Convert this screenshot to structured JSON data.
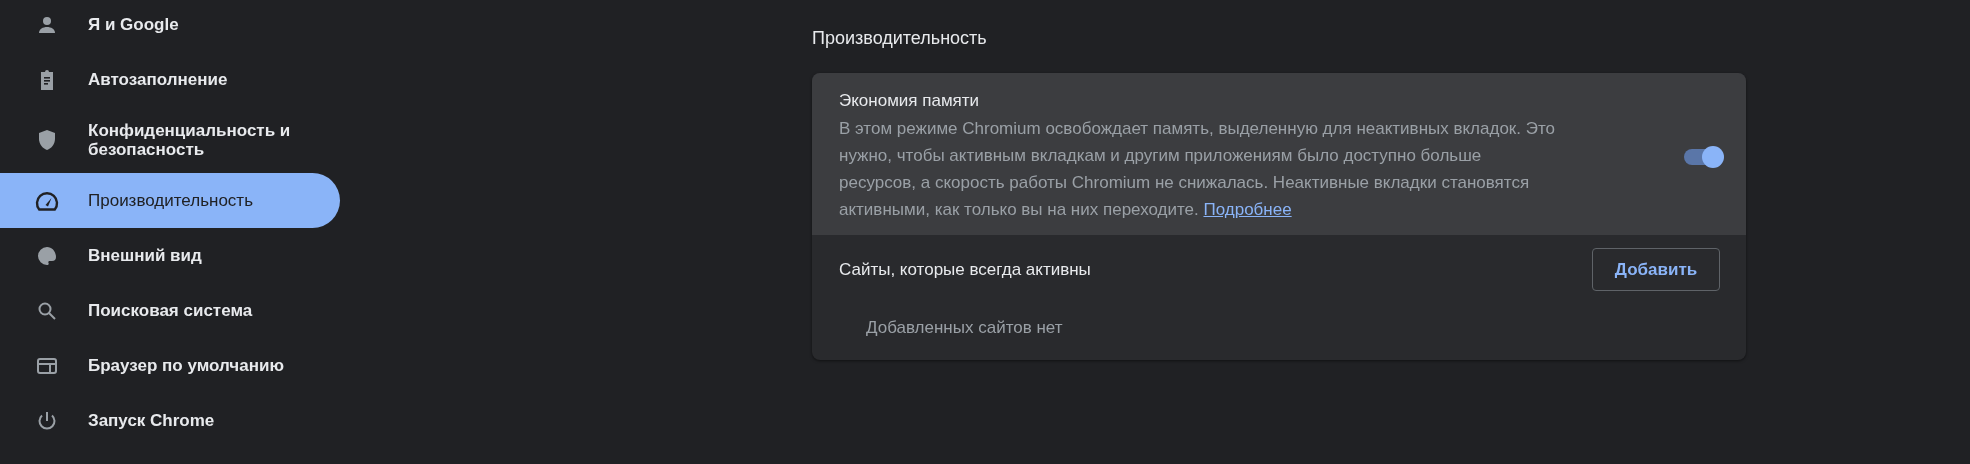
{
  "sidebar": {
    "items": [
      {
        "label": "Я и Google",
        "selected": false
      },
      {
        "label": "Автозаполнение",
        "selected": false
      },
      {
        "label": "Конфиденциальность и безопасность",
        "selected": false
      },
      {
        "label": "Производительность",
        "selected": true
      },
      {
        "label": "Внешний вид",
        "selected": false
      },
      {
        "label": "Поисковая система",
        "selected": false
      },
      {
        "label": "Браузер по умолчанию",
        "selected": false
      },
      {
        "label": "Запуск Chrome",
        "selected": false
      }
    ]
  },
  "main": {
    "title": "Производительность",
    "memory_saver": {
      "title": "Экономия памяти",
      "description": "В этом режиме Chromium освобождает память, выделенную для неактивных вкладок. Это нужно, чтобы активным вкладкам и другим приложениям было доступно больше ресурсов, а скорость работы Chromium не снижалась. Неактивные вкладки становятся активными, как только вы на них переходите.",
      "link": "Подробнее",
      "on": true
    },
    "always_active": {
      "label": "Сайты, которые всегда активны",
      "button": "Добавить",
      "empty": "Добавленных сайтов нет"
    }
  }
}
